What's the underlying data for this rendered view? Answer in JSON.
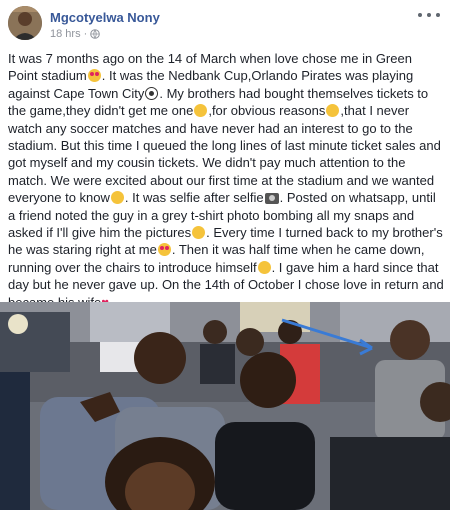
{
  "post": {
    "author": "Mgcotyelwa Nony",
    "timestamp": "18 hrs",
    "privacy_icon": "globe-icon",
    "more_icon": "more-options-icon",
    "paragraph": [
      {
        "t": "It was 7 months ago on the 14 of March when love chose me in Green Point stadium"
      },
      {
        "e": "heart-eyes-emoji"
      },
      {
        "t": ". It was the Nedbank Cup,Orlando Pirates was playing against Cape Town City"
      },
      {
        "e": "soccer-ball-emoji"
      },
      {
        "t": ". My brothers had bought themselves tickets to the game,they didn't get me one"
      },
      {
        "e": "unamused-emoji"
      },
      {
        "t": ",for obvious reasons"
      },
      {
        "e": "smiling-emoji"
      },
      {
        "t": ",that I never watch any soccer matches and have never had an interest to go to the stadium. But this time I queued the long lines of last minute ticket sales and got myself and my cousin tickets. We didn't pay much attention to the match. We were excited about our first time at the stadium and we wanted everyone to know"
      },
      {
        "e": "sunglasses-emoji"
      },
      {
        "t": ". It was selfie after selfie"
      },
      {
        "e": "camera-emoji"
      },
      {
        "t": ". Posted on whatsapp, until a friend noted the guy in a grey t-shirt photo bombing all my snaps and asked if I'll give him the pictures"
      },
      {
        "e": "laughing-emoji"
      },
      {
        "t": ". Every time I turned back to my brother's he was staring right at me"
      },
      {
        "e": "heart-eyes-emoji"
      },
      {
        "t": ". Then it was half time when he came down, running over the chairs to introduce himself"
      },
      {
        "e": "smiling-emoji"
      },
      {
        "t": ". I gave him a hard since that day but he never gave up. On the 14th of October I chose love in return and became his wife"
      },
      {
        "e": "red-heart-emoji"
      }
    ]
  },
  "photo": {
    "description_icon": "stadium-selfie-photo",
    "arrow_color": "#3a7bd5"
  }
}
